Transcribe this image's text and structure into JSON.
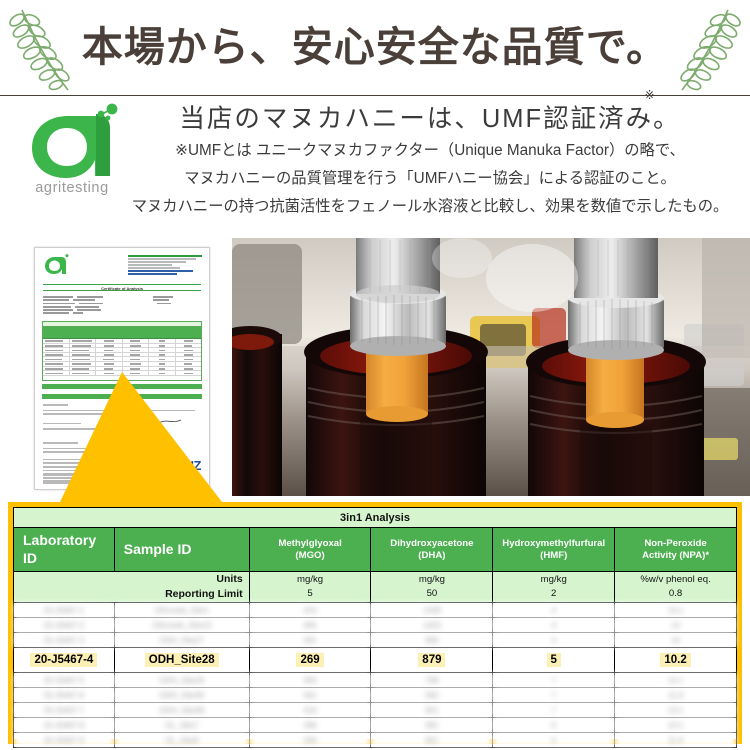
{
  "header": {
    "title": "本場から、安心安全な品質で。",
    "left_ornament": "laurel-branch",
    "right_ornament": "laurel-branch"
  },
  "intro": {
    "logo_name": "agritesting-logo",
    "logo_text": "agritesting",
    "headline": "当店のマヌカハニーは、UMF認証済み。",
    "headline_mark": "※",
    "note_line1": "※UMFとは ユニークマヌカファクター（Unique Manuka Factor）の略で、",
    "note_line2": "マヌカハニーの品質管理を行う「UMFハニー協会」による認証のこと。",
    "note_line3": "マヌカハニーの持つ抗菌活性をフェノール水溶液と比較し、効果を数値で示したもの。"
  },
  "certificate": {
    "title": "Certificate of Analysis",
    "accreditation_logo": "IANZ",
    "highlight_name": "certificate-table-highlight"
  },
  "photo": {
    "alt": "honey-filling-machine-photo"
  },
  "table": {
    "caption": "3in1 Analysis",
    "columns": [
      "Laboratory ID",
      "Sample ID",
      "Methylglyoxal\n(MGO)",
      "Dihydroxyacetone\n(DHA)",
      "Hydroxymethylfurfural\n(HMF)",
      "Non-Peroxide\nActivity (NPA)*"
    ],
    "col_lab": "Laboratory ID",
    "col_sample": "Sample ID",
    "col_mgo_1": "Methylglyoxal",
    "col_mgo_2": "(MGO)",
    "col_dha_1": "Dihydroxyacetone",
    "col_dha_2": "(DHA)",
    "col_hmf_1": "Hydroxymethylfurfural",
    "col_hmf_2": "(HMF)",
    "col_npa_1": "Non-Peroxide",
    "col_npa_2": "Activity (NPA)*",
    "units_label": "Units",
    "reporting_limit_label": "Reporting Limit",
    "units": [
      "mg/kg",
      "mg/kg",
      "mg/kg",
      "%w/v phenol eq."
    ],
    "reporting_limits": [
      "5",
      "50",
      "2",
      "0.8"
    ],
    "highlighted_row": {
      "laboratory_id": "20-J5467-4",
      "sample_id": "ODH_Site28",
      "mgo": "269",
      "dha": "879",
      "hmf": "5",
      "npa": "10.2"
    },
    "blurred_rows_above": 3,
    "blurred_rows_below": 5
  },
  "colors": {
    "brand_green": "#4caf50",
    "light_green": "#d6f5cf",
    "highlight_yellow": "#ffc000",
    "text_highlight": "#fdf0b5",
    "header_text": "#4a4039",
    "leaf_green": "#7dab6e"
  }
}
